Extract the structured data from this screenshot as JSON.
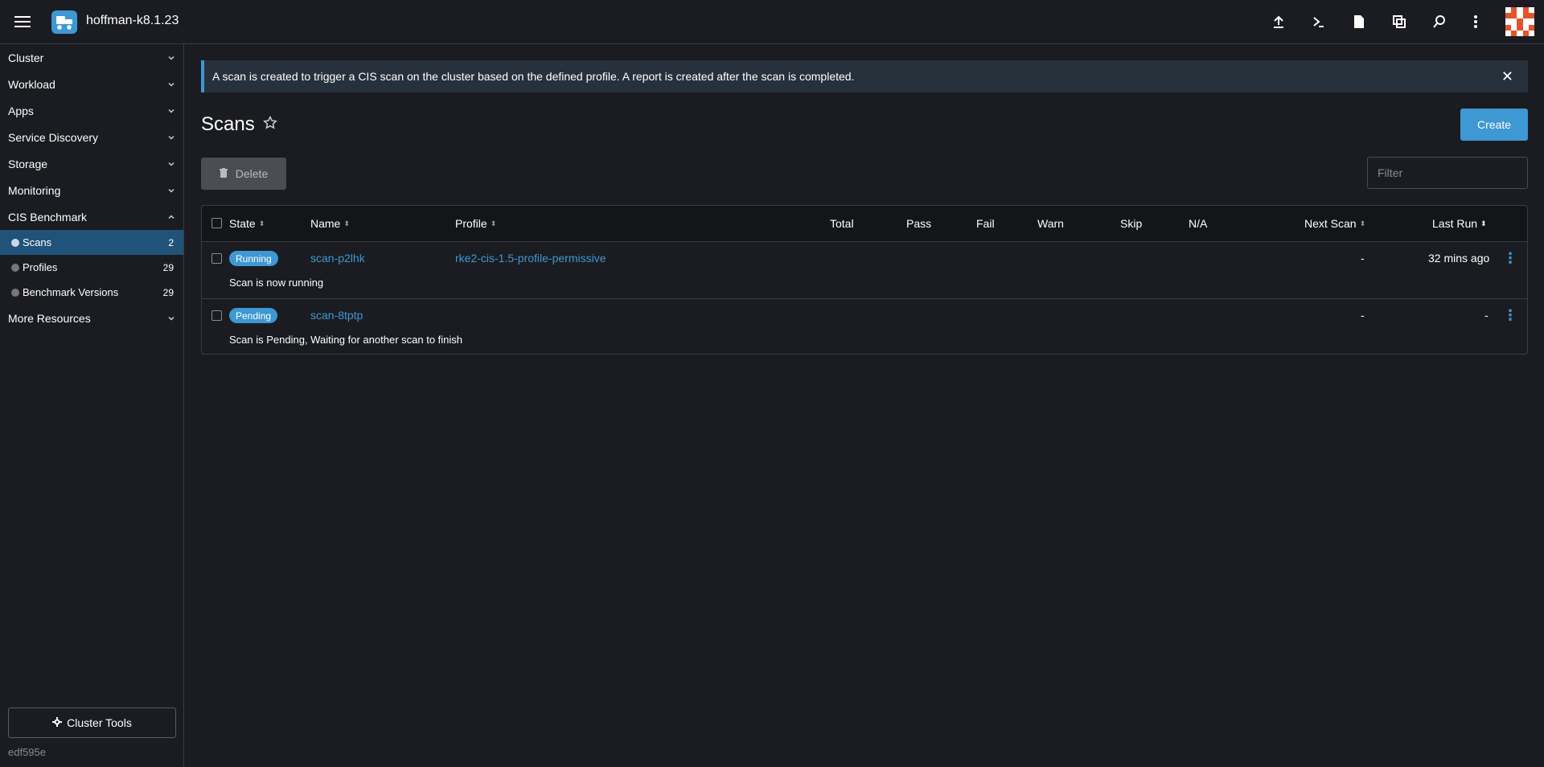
{
  "header": {
    "cluster_name": "hoffman-k8.1.23",
    "icons": [
      "upload-icon",
      "terminal-icon",
      "file-icon",
      "copy-config-icon",
      "search-icon",
      "more-vert-icon"
    ]
  },
  "sidebar": {
    "groups": [
      {
        "label": "Cluster"
      },
      {
        "label": "Workload"
      },
      {
        "label": "Apps"
      },
      {
        "label": "Service Discovery"
      },
      {
        "label": "Storage"
      },
      {
        "label": "Monitoring"
      },
      {
        "label": "CIS Benchmark"
      },
      {
        "label": "More Resources"
      }
    ],
    "cis_items": [
      {
        "label": "Scans",
        "count": "2"
      },
      {
        "label": "Profiles",
        "count": "29"
      },
      {
        "label": "Benchmark Versions",
        "count": "29"
      }
    ],
    "cluster_tools_label": "Cluster Tools",
    "version": "edf595e"
  },
  "banner": {
    "text": "A scan is created to trigger a CIS scan on the cluster based on the defined profile. A report is created after the scan is completed.",
    "close": "✕"
  },
  "page": {
    "title": "Scans",
    "create_label": "Create",
    "delete_label": "Delete",
    "filter_placeholder": "Filter"
  },
  "table": {
    "columns": [
      "State",
      "Name",
      "Profile",
      "Total",
      "Pass",
      "Fail",
      "Warn",
      "Skip",
      "N/A",
      "Next Scan",
      "Last Run"
    ],
    "rows": [
      {
        "state": "Running",
        "name": "scan-p2lhk",
        "profile": "rke2-cis-1.5-profile-permissive",
        "next_scan": "-",
        "last_run": "32 mins ago",
        "description": "Scan is now running"
      },
      {
        "state": "Pending",
        "name": "scan-8tptp",
        "profile": "",
        "next_scan": "-",
        "last_run": "-",
        "description": "Scan is Pending, Waiting for another scan to finish"
      }
    ]
  },
  "colors": {
    "accent": "#3d98d3",
    "active_nav": "#21537a",
    "background": "#1b1c21"
  }
}
